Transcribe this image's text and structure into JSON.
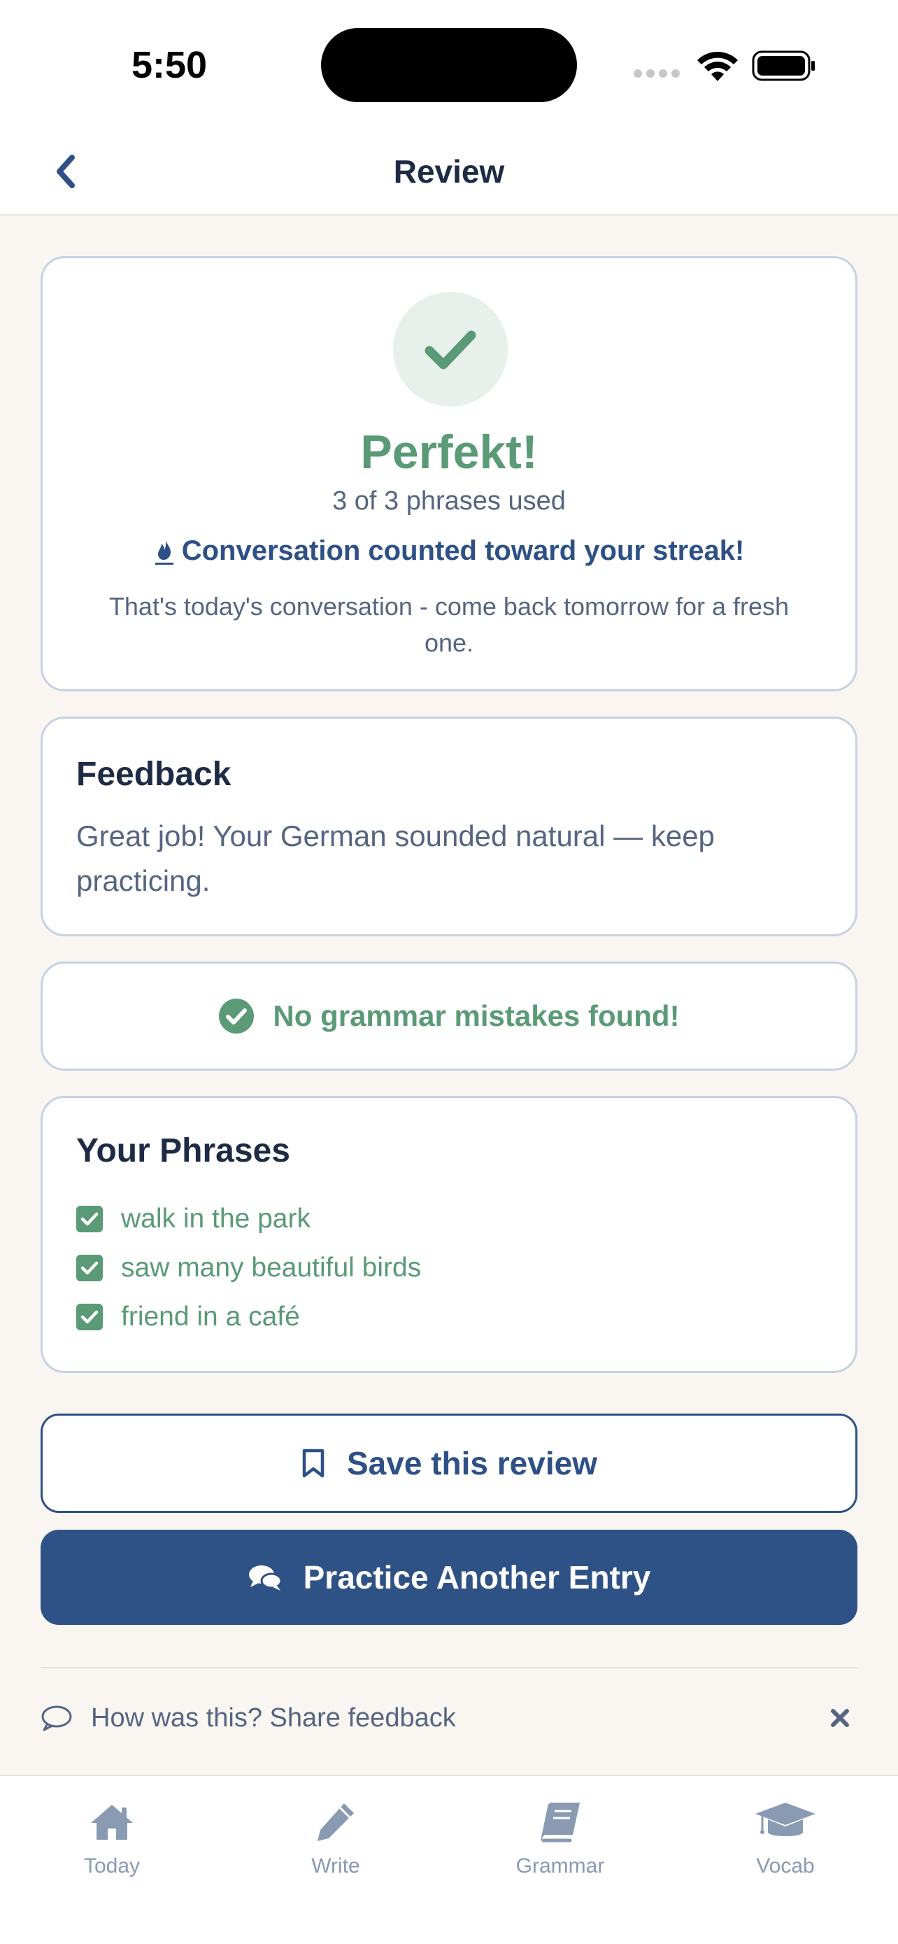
{
  "status_bar": {
    "time": "5:50"
  },
  "nav": {
    "title": "Review",
    "back_icon": "chevron-left-icon"
  },
  "result": {
    "title": "Perfekt!",
    "phrases_used": "3 of 3 phrases used",
    "streak_text": "Conversation counted toward your streak!",
    "streak_icon": "flame-icon",
    "message": "That's today's conversation - come back tomorrow for a fresh one."
  },
  "feedback": {
    "title": "Feedback",
    "text": "Great job! Your German sounded natural — keep practicing."
  },
  "grammar": {
    "text": "No grammar mistakes found!"
  },
  "phrases": {
    "title": "Your Phrases",
    "items": [
      {
        "text": "walk in the park",
        "checked": true
      },
      {
        "text": "saw many beautiful birds",
        "checked": true
      },
      {
        "text": "friend in a café",
        "checked": true
      }
    ]
  },
  "actions": {
    "save_label": "Save this review",
    "practice_label": "Practice Another Entry"
  },
  "share": {
    "text": "How was this? Share feedback"
  },
  "tabs": [
    {
      "label": "Today",
      "icon": "home-icon"
    },
    {
      "label": "Write",
      "icon": "pencil-icon"
    },
    {
      "label": "Grammar",
      "icon": "book-icon"
    },
    {
      "label": "Vocab",
      "icon": "graduation-cap-icon"
    }
  ],
  "colors": {
    "primary": "#2f5286",
    "success": "#5a9a76",
    "background": "#f9f6f1",
    "tab_inactive": "#8a9ab3"
  }
}
